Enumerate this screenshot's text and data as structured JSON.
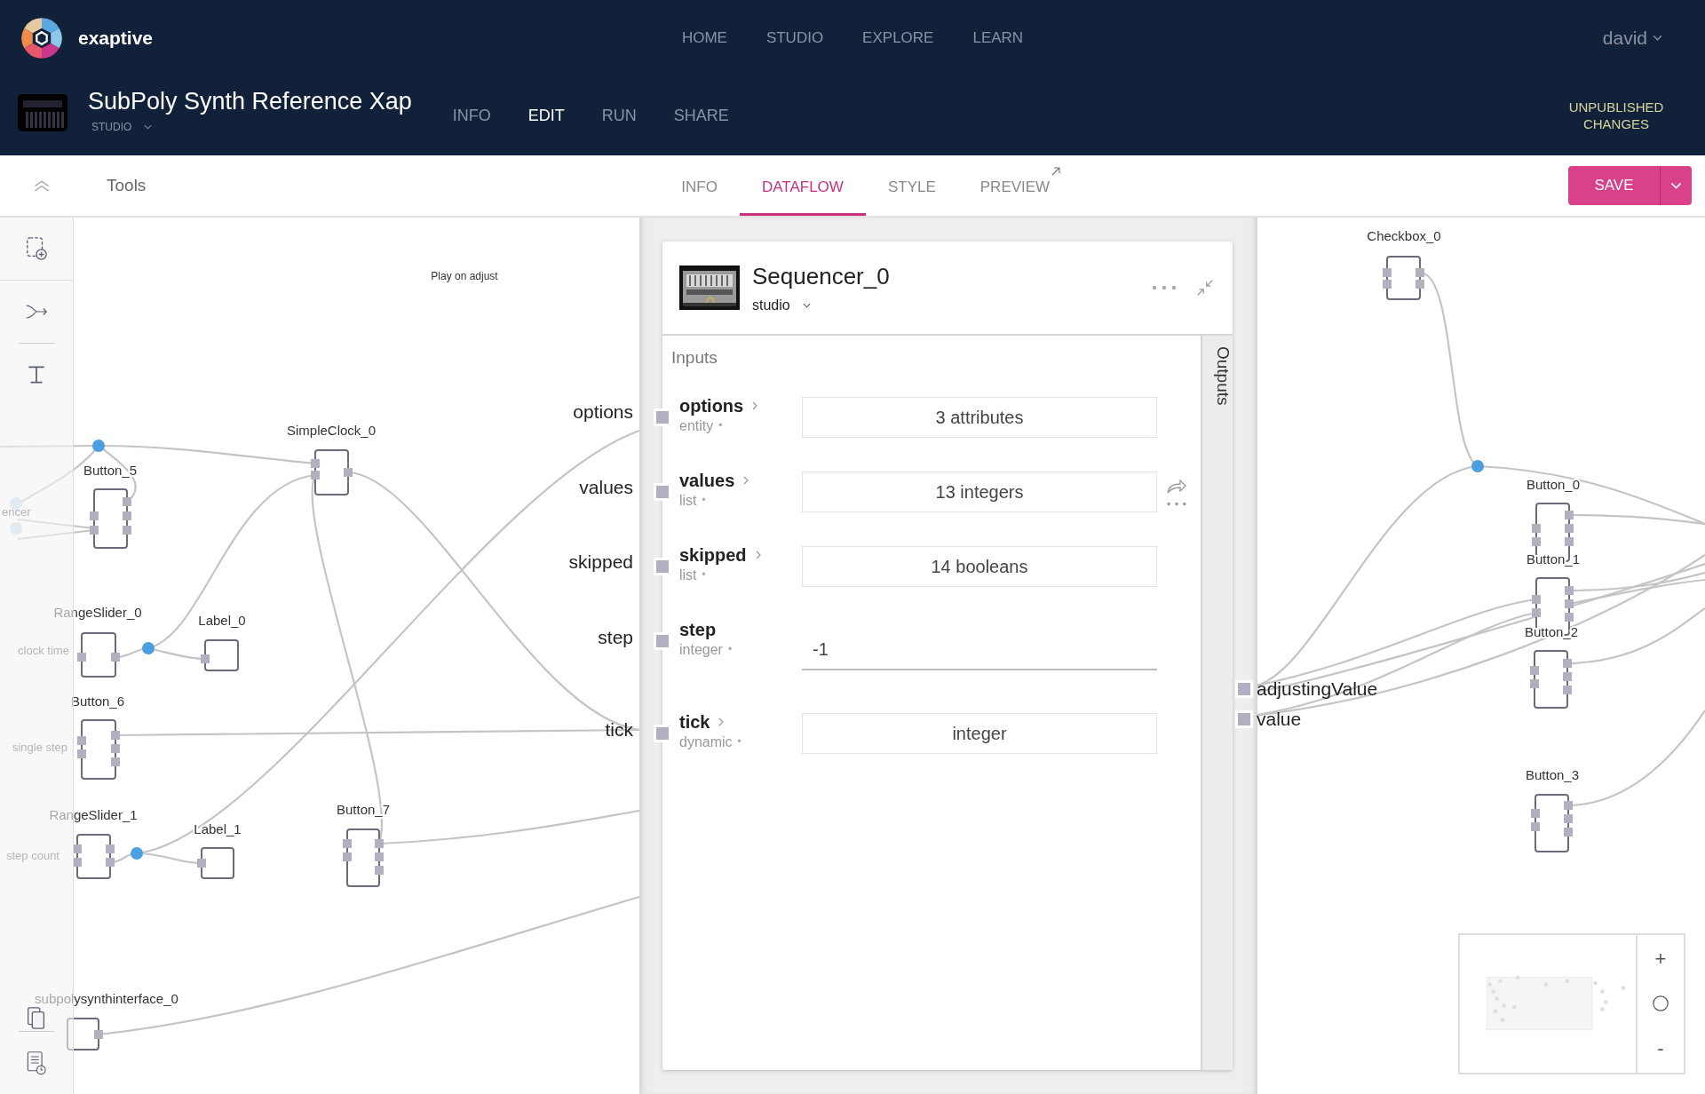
{
  "header": {
    "brand": "exaptive",
    "nav": [
      "HOME",
      "STUDIO",
      "EXPLORE",
      "LEARN"
    ],
    "user": "david"
  },
  "project": {
    "title": "SubPoly Synth Reference Xap",
    "workspace": "STUDIO",
    "status": "UNPUBLISHED CHANGES",
    "tabs": [
      {
        "label": "INFO",
        "selected": false
      },
      {
        "label": "EDIT",
        "selected": true
      },
      {
        "label": "RUN",
        "selected": false
      },
      {
        "label": "SHARE",
        "selected": false
      }
    ]
  },
  "toolbar": {
    "tools_label": "Tools",
    "save_button": "SAVE",
    "tabs": [
      {
        "label": "INFO",
        "selected": false
      },
      {
        "label": "DATAFLOW",
        "selected": true
      },
      {
        "label": "STYLE",
        "selected": false
      },
      {
        "label": "PREVIEW",
        "selected": false
      }
    ]
  },
  "canvas": {
    "note": "Play on adjust",
    "hints": [
      "encer",
      "clock time",
      "single step",
      "step count"
    ],
    "nodes": [
      {
        "label": "Button_5"
      },
      {
        "label": "SimpleClock_0"
      },
      {
        "label": "RangeSlider_0"
      },
      {
        "label": "Label_0"
      },
      {
        "label": "Button_6"
      },
      {
        "label": "RangeSlider_1"
      },
      {
        "label": "Label_1"
      },
      {
        "label": "Button_7"
      },
      {
        "label": "subpolysynthinterface_0"
      },
      {
        "label": "Checkbox_0"
      },
      {
        "label": "Button_0"
      },
      {
        "label": "Button_1"
      },
      {
        "label": "Button_2"
      },
      {
        "label": "Button_3"
      }
    ],
    "input_ports": [
      "options",
      "values",
      "skipped",
      "step",
      "tick"
    ],
    "output_ports": [
      "adjustingValue",
      "value"
    ]
  },
  "component": {
    "title": "Sequencer_0",
    "workspace": "studio",
    "inputs_label": "Inputs",
    "outputs_label": "Outputs",
    "inputs": [
      {
        "name": "options",
        "type": "entity",
        "value": "3 attributes",
        "kind": "summary",
        "expandable": true,
        "hovered": false,
        "required_mark": "•"
      },
      {
        "name": "values",
        "type": "list",
        "value": "13 integers",
        "kind": "summary",
        "expandable": true,
        "hovered": true,
        "required_mark": "•"
      },
      {
        "name": "skipped",
        "type": "list",
        "value": "14 booleans",
        "kind": "summary",
        "expandable": true,
        "hovered": false,
        "required_mark": "•"
      },
      {
        "name": "step",
        "type": "integer",
        "value": "-1",
        "kind": "field",
        "expandable": false,
        "hovered": false,
        "required_mark": "•"
      },
      {
        "name": "tick",
        "type": "dynamic",
        "value": "integer",
        "kind": "summary",
        "expandable": true,
        "hovered": false,
        "required_mark": "•"
      }
    ]
  },
  "minimap": {
    "zoom_in": "+",
    "zoom_out": "-"
  }
}
